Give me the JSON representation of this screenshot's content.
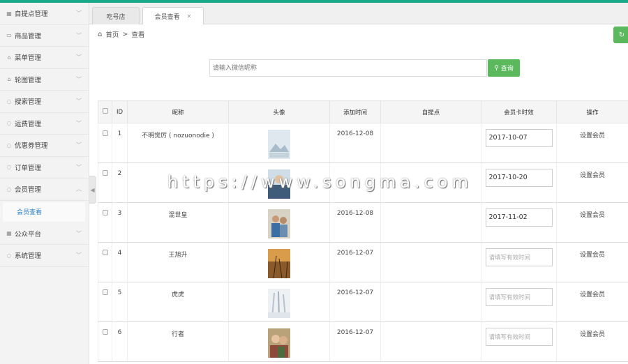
{
  "sidebar": {
    "items": [
      {
        "label": "自提点管理",
        "icon": "grid-icon"
      },
      {
        "label": "商品管理",
        "icon": "card-icon"
      },
      {
        "label": "菜单管理",
        "icon": "home-icon"
      },
      {
        "label": "轮图管理",
        "icon": "home-icon"
      },
      {
        "label": "搜索管理",
        "icon": "circle-icon"
      },
      {
        "label": "运费管理",
        "icon": "circle-icon"
      },
      {
        "label": "优惠券管理",
        "icon": "circle-icon"
      },
      {
        "label": "订单管理",
        "icon": "circle-icon"
      },
      {
        "label": "会员管理",
        "icon": "circle-icon"
      }
    ],
    "sub_item": "会员查看",
    "items_after": [
      {
        "label": "公众平台",
        "icon": "grid-icon"
      },
      {
        "label": "系统管理",
        "icon": "circle-icon"
      }
    ]
  },
  "tabs": [
    {
      "label": "吃号店"
    },
    {
      "label": "会员查看"
    }
  ],
  "breadcrumb": {
    "home": "首页",
    "sep": ">",
    "current": "查看"
  },
  "search": {
    "placeholder": "请输入微信昵称",
    "button": "查询"
  },
  "table": {
    "headers": [
      "ID",
      "昵称",
      "头像",
      "添加时间",
      "自提点",
      "会员卡时效",
      "操作"
    ],
    "rows": [
      {
        "id": "1",
        "nickname": "不明觉厉 ( nozuonodie )",
        "added": "2016-12-08",
        "pickup": "",
        "expiry": "2017-10-07",
        "action": "设置会员"
      },
      {
        "id": "2",
        "nickname": "",
        "added": "",
        "pickup": "",
        "expiry": "2017-10-20",
        "action": "设置会员"
      },
      {
        "id": "3",
        "nickname": "混世皇",
        "added": "2016-12-08",
        "pickup": "",
        "expiry": "2017-11-02",
        "action": "设置会员"
      },
      {
        "id": "4",
        "nickname": "王旭升",
        "added": "2016-12-07",
        "pickup": "",
        "expiry": "请填写有效时间",
        "action": "设置会员"
      },
      {
        "id": "5",
        "nickname": "虎虎",
        "added": "2016-12-07",
        "pickup": "",
        "expiry": "请填写有效时间",
        "action": "设置会员"
      },
      {
        "id": "6",
        "nickname": "行者",
        "added": "2016-12-07",
        "pickup": "",
        "expiry": "请填写有效时间",
        "action": "设置会员"
      }
    ]
  },
  "watermark": "https://www.songma.com",
  "colors": {
    "accent_green": "#5cb85c",
    "top_bar": "#1aaa8a",
    "link_blue": "#2e7fc3"
  }
}
